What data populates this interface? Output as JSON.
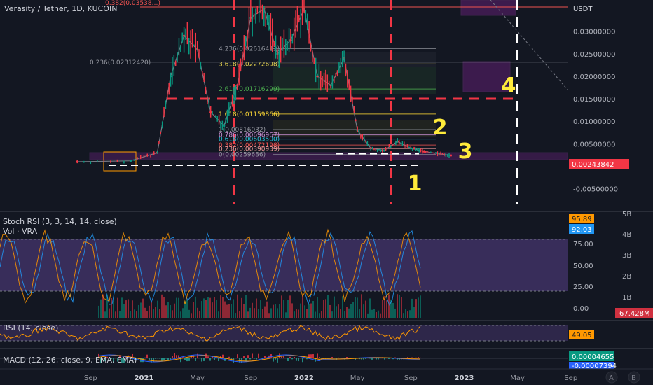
{
  "header": {
    "title": "Verasity / Tether, 1D, KUCOIN"
  },
  "price_axis": {
    "currency": "USDT",
    "ticks": [
      "0.03000000",
      "0.02500000",
      "0.02000000",
      "0.01500000",
      "0.01000000",
      "0.00500000",
      "0.00000000",
      "-0.00500000"
    ],
    "current_price": "0.00243842",
    "current_color": "#f23645"
  },
  "fib_levels": [
    {
      "label": "4.236(0.02616412)",
      "value": 0.02616412,
      "color": "#9598a1"
    },
    {
      "label": "3.618(0.02272698)",
      "value": 0.02272698,
      "color": "#e8d44d"
    },
    {
      "label": "2.618(0.01716299)",
      "value": 0.01716299,
      "color": "#4caf50"
    },
    {
      "label": "1.618(0.01159866)",
      "value": 0.01159866,
      "color": "#fdd835"
    },
    {
      "label": "1(0.00816032)",
      "value": 0.00816032,
      "color": "#9598a1"
    },
    {
      "label": "0.786(0.00696967)",
      "value": 0.00696967,
      "color": "#ce93d8"
    },
    {
      "label": "0.618(0.00603500)",
      "value": 0.006035,
      "color": "#26c6da"
    },
    {
      "label": "0.382(0.00472198)",
      "value": 0.00472198,
      "color": "#ef5350"
    },
    {
      "label": "0.236(0.00390939)",
      "value": 0.00390939,
      "color": "#ef9a9a"
    },
    {
      "label": "0(0.00259686)",
      "value": 0.00259686,
      "color": "#9598a1"
    }
  ],
  "left_fib": {
    "label": "0.236(0.02312420)",
    "value": 0.0231242
  },
  "top_fib": {
    "label": "0.382(0.03538…)",
    "value": 0.0354
  },
  "annotations": [
    "1",
    "2",
    "3",
    "4"
  ],
  "x_axis": {
    "labels": [
      "Sep",
      "2021",
      "May",
      "Sep",
      "2022",
      "May",
      "Sep",
      "2023",
      "May",
      "Sep"
    ]
  },
  "stoch_rsi": {
    "title": "Stoch RSI (3, 3, 14, 14, close)",
    "vol_title": "Vol · VRA",
    "badge_k": "95.89",
    "badge_d": "92.03",
    "color_k": "#ff9800",
    "color_d": "#2196f3",
    "ticks": [
      "75.00",
      "50.00",
      "25.00",
      "0.00"
    ],
    "vol_ticks": [
      "5B",
      "4B",
      "3B",
      "2B",
      "1B"
    ],
    "vol_badge": "67.428M"
  },
  "rsi": {
    "title": "RSI (14, close)",
    "badge": "49.05",
    "color": "#ff9800"
  },
  "macd": {
    "title": "MACD (12, 26, close, 9, EMA, EMA)",
    "badge_macd": "0.00004655",
    "badge_signal": "-0.00007394",
    "color_macd": "#089981",
    "color_signal": "#2962ff"
  },
  "corner": {
    "auto": "A",
    "log": "B"
  },
  "chart_data": {
    "type": "line",
    "title": "Verasity / Tether, 1D, KUCOIN",
    "ylabel": "USDT",
    "ylim": [
      -0.0085,
      0.0375
    ],
    "x": [
      "2020-08",
      "2020-12",
      "2021-02",
      "2021-03",
      "2021-04",
      "2021-05",
      "2021-06",
      "2021-07",
      "2021-08",
      "2021-09",
      "2021-10",
      "2021-11",
      "2021-12",
      "2022-01",
      "2022-02",
      "2022-03",
      "2022-04",
      "2022-05",
      "2022-06",
      "2022-07",
      "2022-08",
      "2022-09",
      "2022-10",
      "2022-11",
      "2022-12"
    ],
    "series": [
      {
        "values": [
          0.001,
          0.0012,
          0.003,
          0.02,
          0.029,
          0.026,
          0.012,
          0.009,
          0.018,
          0.033,
          0.035,
          0.025,
          0.028,
          0.035,
          0.02,
          0.018,
          0.024,
          0.008,
          0.004,
          0.0035,
          0.0055,
          0.004,
          0.0033,
          0.0028,
          0.0024
        ]
      }
    ]
  }
}
